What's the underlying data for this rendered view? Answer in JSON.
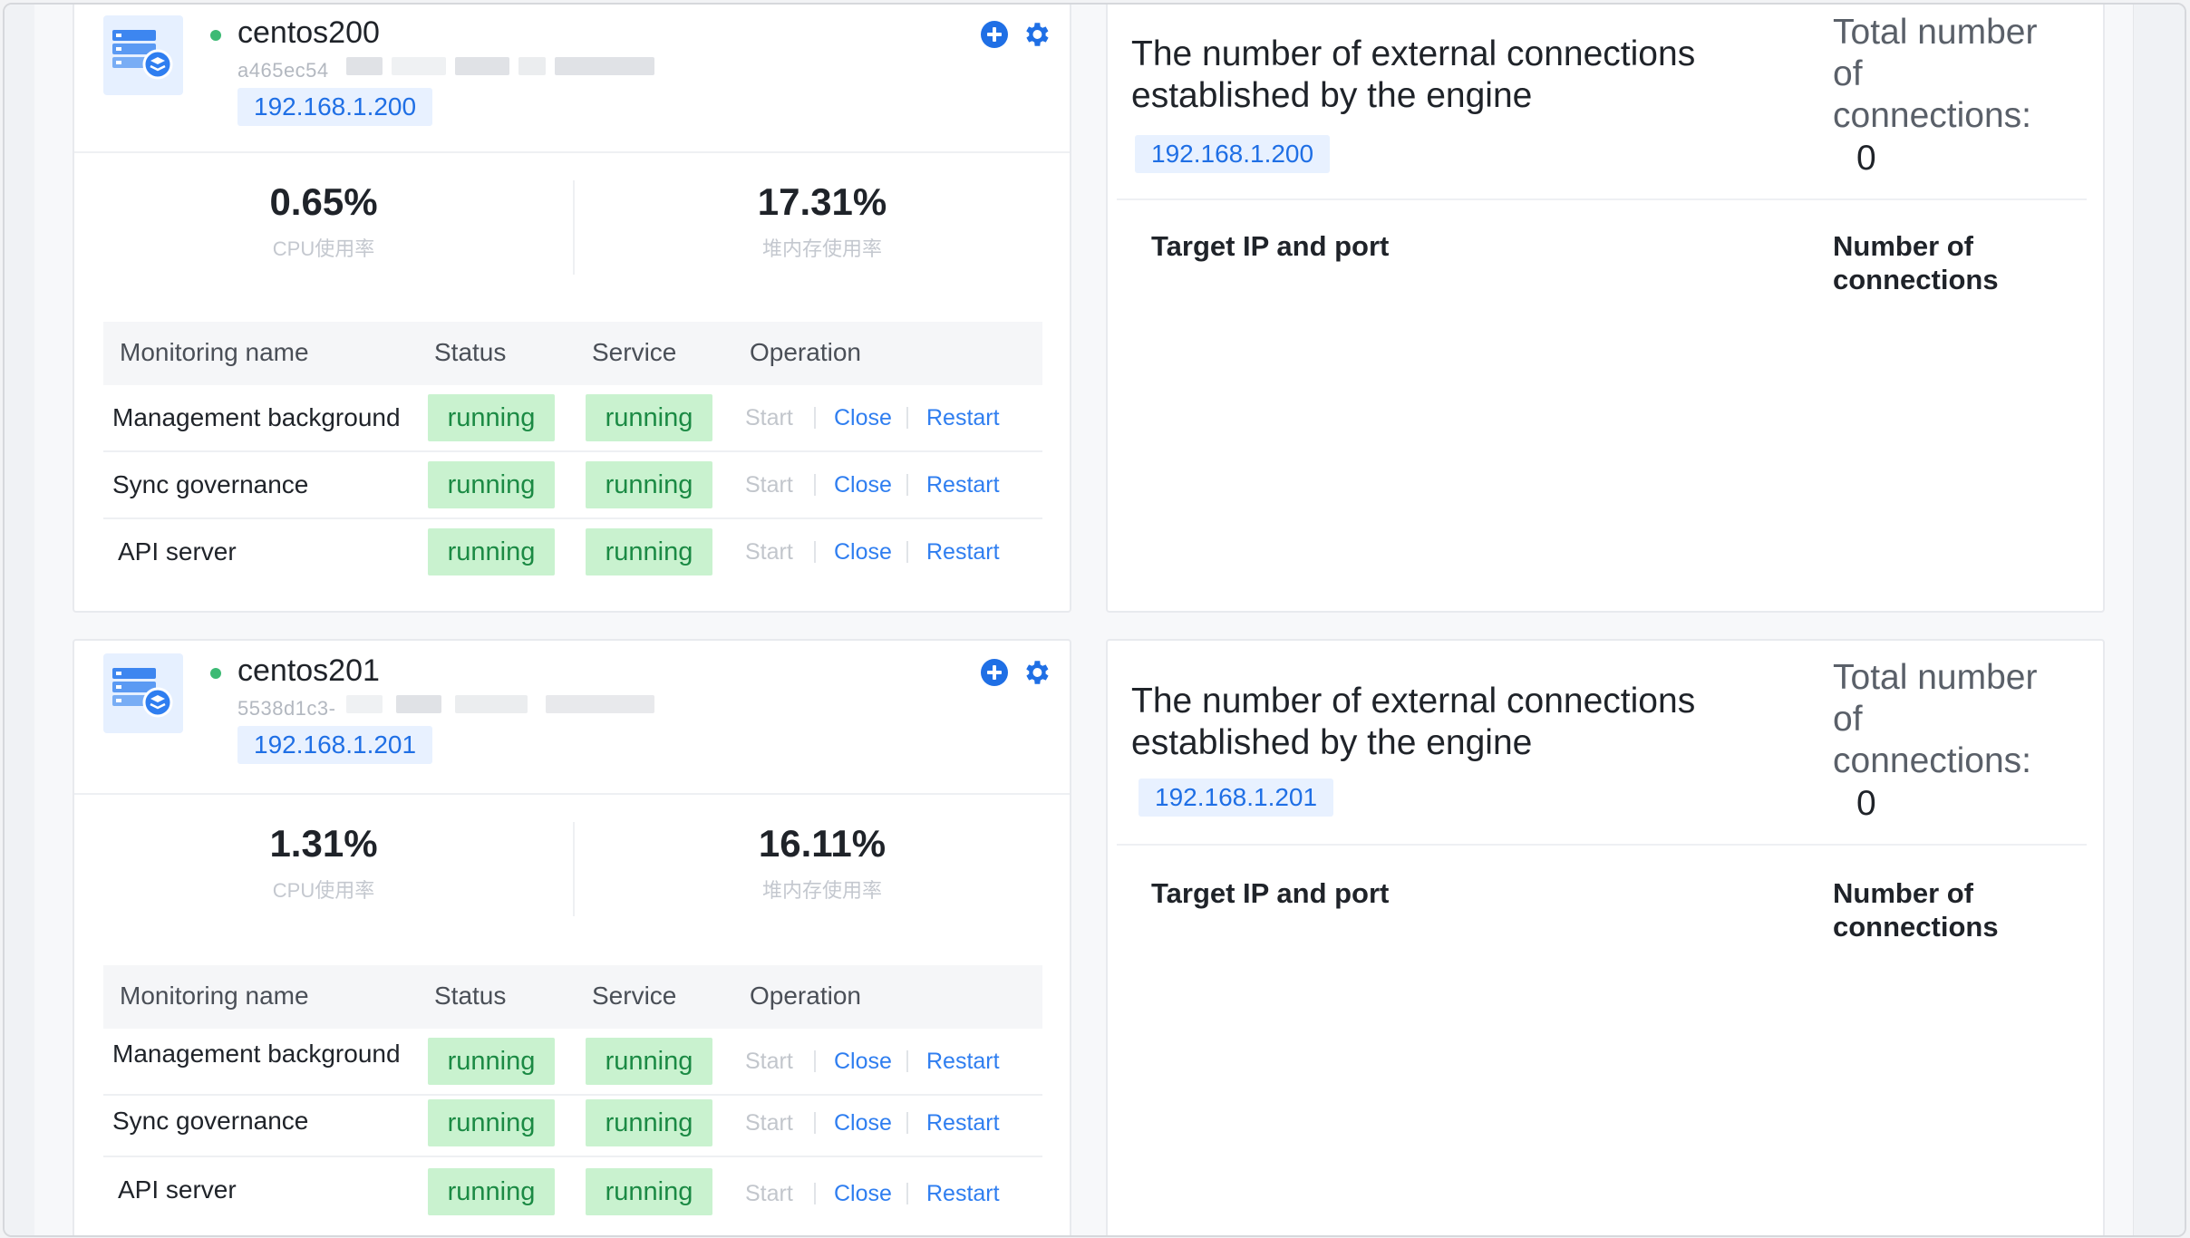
{
  "hosts": [
    {
      "name": "centos200",
      "id": "a465ec54",
      "ip": "192.168.1.200",
      "cpu_value": "0.65%",
      "cpu_label": "CPU使用率",
      "heap_value": "17.31%",
      "heap_label": "堆内存使用率",
      "connections": {
        "title": "The number of external connections established by the engine",
        "ip": "192.168.1.200",
        "total_label": "Total number of connections:",
        "total_value": "0",
        "col_target": "Target IP and port",
        "col_count": "Number of connections"
      }
    },
    {
      "name": "centos201",
      "id": "5538d1c3-",
      "ip": "192.168.1.201",
      "cpu_value": "1.31%",
      "cpu_label": "CPU使用率",
      "heap_value": "16.11%",
      "heap_label": "堆内存使用率",
      "connections": {
        "title": "The number of external connections established by the engine",
        "ip": "192.168.1.201",
        "total_label": "Total number of connections:",
        "total_value": "0",
        "col_target": "Target IP and port",
        "col_count": "Number of connections"
      }
    }
  ],
  "monitor_table": {
    "columns": [
      "Monitoring name",
      "Status",
      "Service",
      "Operation"
    ],
    "rows": [
      {
        "name": "Management background",
        "status": "running",
        "service": "running"
      },
      {
        "name": "Sync governance",
        "status": "running",
        "service": "running"
      },
      {
        "name": "API server",
        "status": "running",
        "service": "running"
      }
    ],
    "operations": [
      "Start",
      "Close",
      "Restart"
    ]
  },
  "colors": {
    "accent": "#1f6fe5",
    "running_bg": "#c9f2cf",
    "running_text": "#1b8a44",
    "online_dot": "#3cba74"
  },
  "icons": [
    "server-stack-icon",
    "plus-circle-icon",
    "gear-icon",
    "online-status-dot"
  ]
}
